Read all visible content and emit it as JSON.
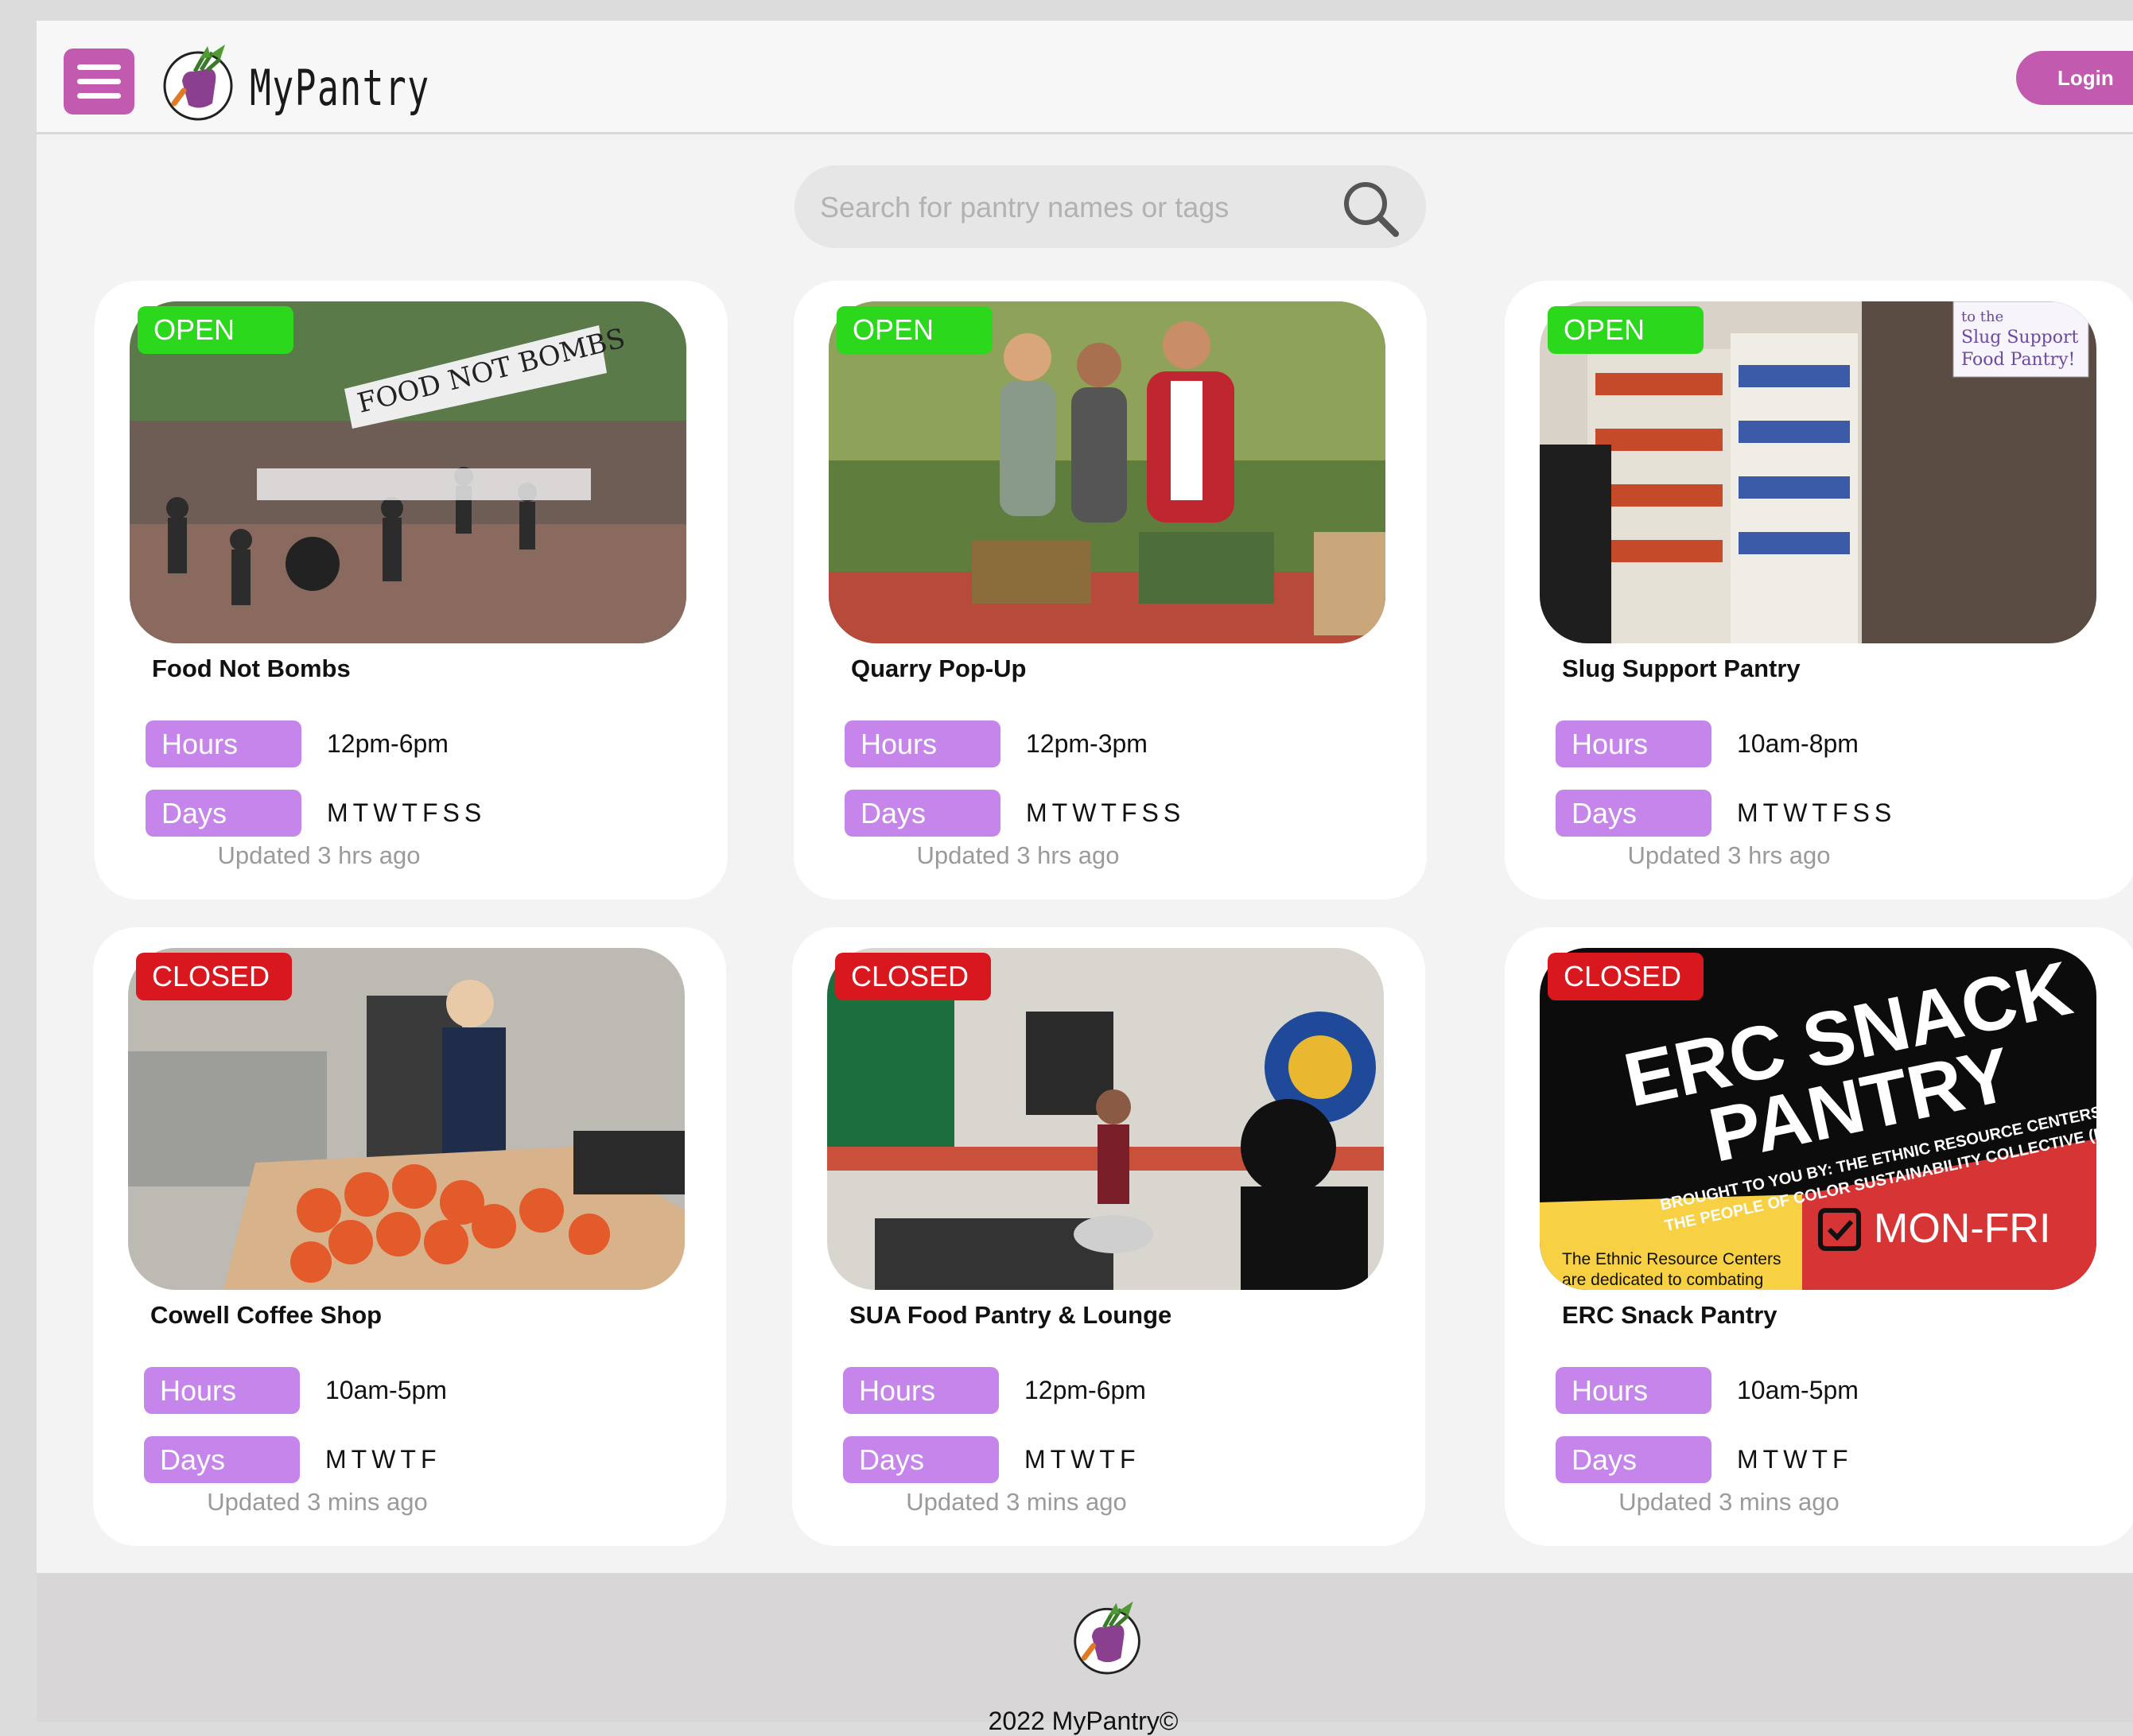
{
  "header": {
    "brand": "MyPantry",
    "login_label": "Login"
  },
  "search": {
    "placeholder": "Search for pantry names or tags"
  },
  "labels": {
    "hours": "Hours",
    "days": "Days"
  },
  "pantries": [
    {
      "status": "OPEN",
      "name": "Food Not Bombs",
      "hours": "12pm-6pm",
      "days": "MTWTFSS",
      "updated": "Updated 3 hrs ago",
      "photo_banner": "FOOD NOT BOMBS"
    },
    {
      "status": "OPEN",
      "name": "Quarry Pop-Up",
      "hours": "12pm-3pm",
      "days": "MTWTFSS",
      "updated": "Updated 3 hrs ago"
    },
    {
      "status": "OPEN",
      "name": "Slug Support Pantry",
      "hours": "10am-8pm",
      "days": "MTWTFSS",
      "updated": "Updated 3 hrs ago",
      "photo_sign": [
        "to the",
        "Slug Support",
        "Food Pantry!"
      ]
    },
    {
      "status": "CLOSED",
      "name": "Cowell Coffee Shop",
      "hours": "10am-5pm",
      "days": "MTWTF",
      "updated": "Updated 3 mins ago"
    },
    {
      "status": "CLOSED",
      "name": "SUA Food Pantry & Lounge",
      "hours": "12pm-6pm",
      "days": "MTWTF",
      "updated": "Updated 3 mins ago"
    },
    {
      "status": "CLOSED",
      "name": "ERC Snack Pantry",
      "hours": "10am-5pm",
      "days": "MTWTF",
      "updated": "Updated 3 mins ago",
      "poster": {
        "line1": "ERC SNACK",
        "line2": "PANTRY",
        "sub1": "BROUGHT TO YOU BY: THE ETHNIC RESOURCE CENTERS AND",
        "sub2": "THE PEOPLE OF COLOR SUSTAINABILITY COLLECTIVE (POCSC)",
        "days": "MON-FRI",
        "blurb1": "The Ethnic Resource Centers",
        "blurb2": "are dedicated to combating"
      }
    }
  ],
  "footer": {
    "copyright": "2022 MyPantry©"
  },
  "colors": {
    "brand": "#c25bb0",
    "pill": "#c585ea",
    "open": "#2bd81c",
    "closed": "#d8181e"
  }
}
